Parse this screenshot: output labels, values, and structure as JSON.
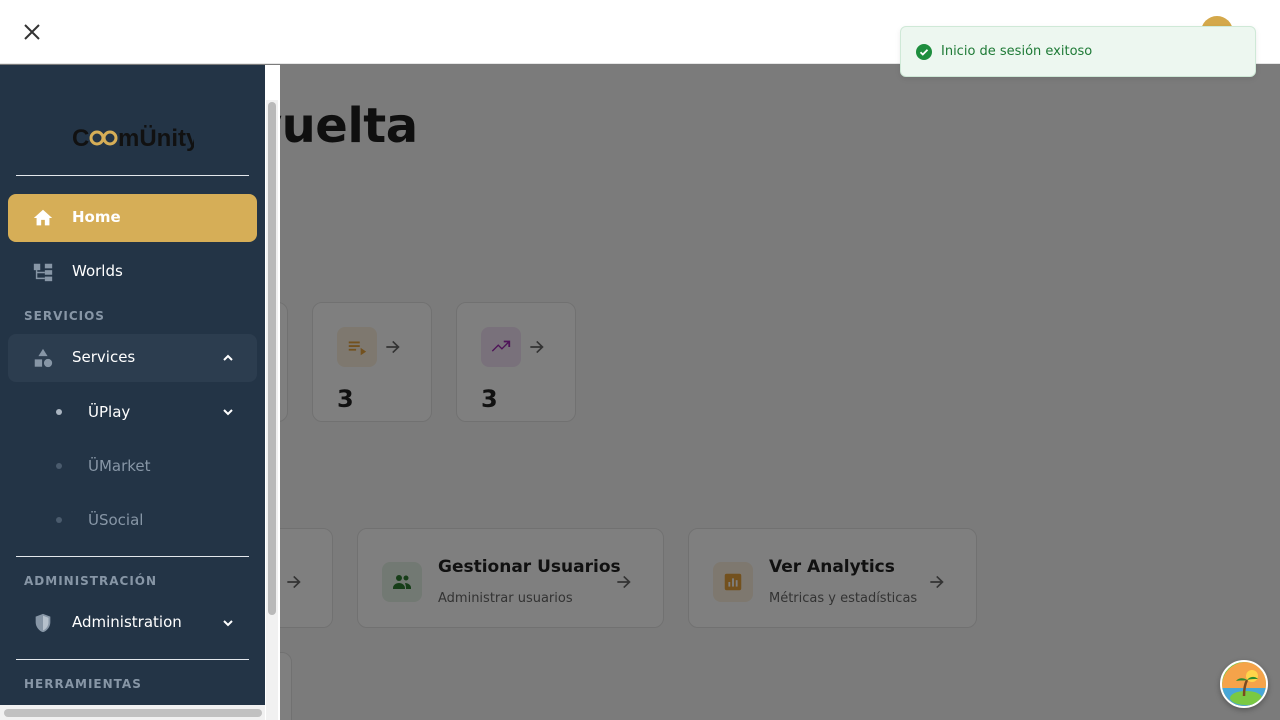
{
  "page": {
    "welcome_fragment": "o de vuelta",
    "stats": [
      {
        "icon": "playlist-play-icon",
        "value": "3",
        "accent": "#e6a23c"
      },
      {
        "icon": "trending-up-icon",
        "value": "3",
        "accent": "#9c27b0"
      }
    ],
    "actions": [
      {
        "title": "Gestionar Usuarios",
        "subtitle": "Administrar usuarios",
        "icon": "group-icon",
        "accent": "#2e7d32"
      },
      {
        "title": "Ver Analytics",
        "subtitle": "Métricas y estadísticas",
        "icon": "analytics-icon",
        "accent": "#e6a23c"
      }
    ]
  },
  "toast": {
    "message": "Inicio de sesión exitoso",
    "color": "#1e8e3e"
  },
  "sidebar": {
    "brand": "CooMÜnity",
    "brand_color": "#d6ae57",
    "items": [
      {
        "label": "Home",
        "icon": "home-icon",
        "active": true
      },
      {
        "label": "Worlds",
        "icon": "hierarchy-icon"
      }
    ],
    "sections": {
      "services": "SERVICIOS",
      "admin": "ADMINISTRACIÓN",
      "tools": "HERRAMIENTAS"
    },
    "services": {
      "label": "Services",
      "icon": "category-icon",
      "expanded": true,
      "children": [
        "ÜPlay",
        "ÜMarket",
        "ÜSocial"
      ]
    },
    "administration": {
      "label": "Administration",
      "icon": "shield-icon"
    }
  }
}
